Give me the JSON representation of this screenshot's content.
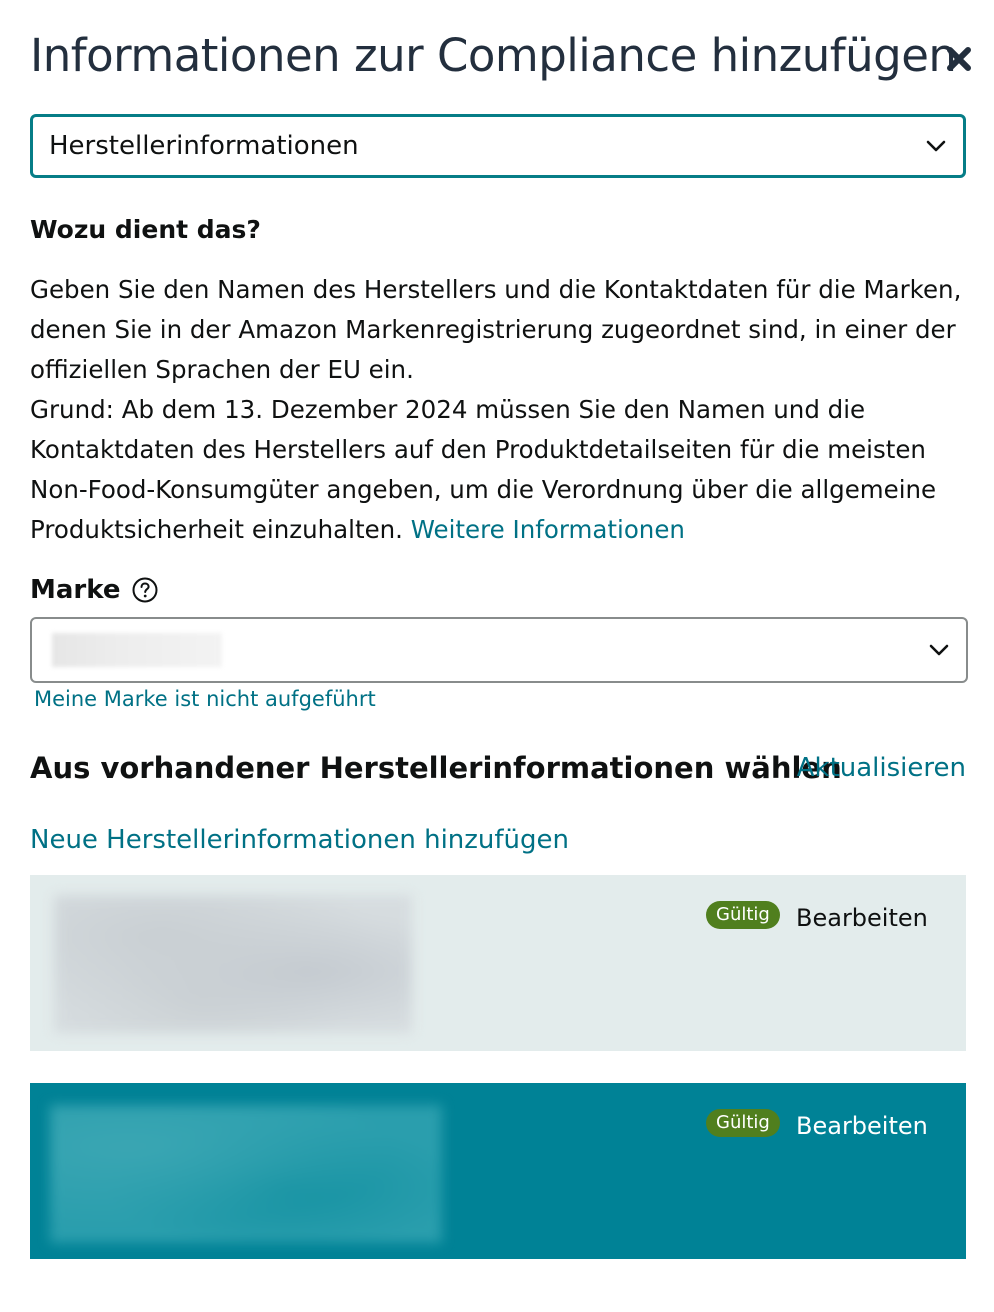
{
  "dialog": {
    "title": "Informationen zur Compliance hinzufügen",
    "close_icon": "close-icon"
  },
  "info_type_select": {
    "value": "Herstellerinformationen",
    "icon": "chevron-down-icon"
  },
  "explanation": {
    "heading": "Wozu dient das?",
    "paragraph1": "Geben Sie den Namen des Herstellers und die Kontaktdaten für die Marken, denen Sie in der Amazon Markenregistrierung zugeordnet sind, in einer der offiziellen Sprachen der EU ein.",
    "paragraph2": "Grund: Ab dem 13. Dezember 2024 müssen Sie den Namen und die Kontaktdaten des Herstellers auf den Produktdetailseiten für die meisten Non-Food-Konsumgüter angeben, um die Verordnung über die allgemeine Produktsicherheit einzuhalten.",
    "more_info_link": "Weitere Informationen"
  },
  "brand": {
    "label": "Marke",
    "help_icon": "help-circle-icon",
    "select_icon": "chevron-down-icon",
    "not_listed_link": "Meine Marke ist nicht aufgeführt"
  },
  "manufacturer_section": {
    "heading": "Aus vorhandener Herstellerinformationen wählen",
    "refresh_link": "Aktualisieren",
    "add_link": "Neue Herstellerinformationen hinzufügen",
    "entries": [
      {
        "status": "Gültig",
        "edit_label": "Bearbeiten",
        "selected": false
      },
      {
        "status": "Gültig",
        "edit_label": "Bearbeiten",
        "selected": true
      }
    ]
  },
  "colors": {
    "accent": "#067d87",
    "link": "#007185",
    "selected_card": "#008296",
    "card_background": "#e3ecec",
    "valid_badge": "#507f1e"
  }
}
